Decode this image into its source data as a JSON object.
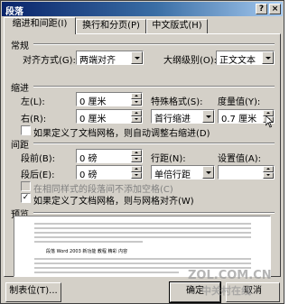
{
  "window": {
    "title": "段落",
    "help_btn": "?",
    "close_btn": "×"
  },
  "tabs": [
    {
      "label": "缩进和间距(I)",
      "active": true
    },
    {
      "label": "换行和分页(P)",
      "active": false
    },
    {
      "label": "中文版式(H)",
      "active": false
    }
  ],
  "general": {
    "heading": "常规",
    "align_label": "对齐方式(G):",
    "align_value": "两端对齐",
    "outline_label": "大纲级别(O):",
    "outline_value": "正文文本"
  },
  "indent": {
    "heading": "缩进",
    "left_label": "左(L):",
    "left_value": "0 厘米",
    "right_label": "右(R):",
    "right_value": "0 厘米",
    "special_label": "特殊格式(S):",
    "special_value": "首行缩进",
    "by_label": "度量值(Y):",
    "by_value": "0.7 厘米",
    "auto_adjust_label": "如果定义了文档网格，则自动调整右缩进(D)",
    "auto_adjust_checked": false
  },
  "spacing": {
    "heading": "间距",
    "before_label": "段前(B):",
    "before_value": "0 磅",
    "after_label": "段后(E):",
    "after_value": "0 磅",
    "line_label": "行距(N):",
    "line_value": "单倍行距",
    "at_label": "设置值(A):",
    "at_value": "",
    "no_space_label": "在相同样式的段落间不添加空格(C)",
    "no_space_checked": false,
    "snap_grid_label": "如果定义了文档网格，则与网格对齐(W)",
    "snap_grid_checked": true
  },
  "preview": {
    "heading": "预览",
    "sample_text": "段落 Word 2003 新功能 教程 精彩 内容"
  },
  "buttons": {
    "tabs": "制表位(T)...",
    "ok": "确定",
    "cancel": "取消"
  },
  "watermark": {
    "site": "ZOL.COM.CN",
    "sub": "中关村在线"
  }
}
